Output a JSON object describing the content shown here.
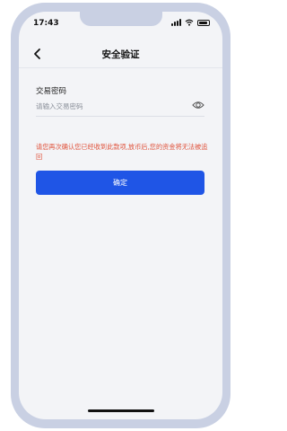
{
  "status_bar": {
    "time": "17:43",
    "icons": [
      "signal-icon",
      "wifi-icon",
      "battery-icon"
    ]
  },
  "nav": {
    "title": "安全验证",
    "back_icon": "chevron-left-icon"
  },
  "form": {
    "field_label": "交易密码",
    "password_value": "",
    "password_placeholder": "请输入交易密码",
    "toggle_icon": "eye-icon"
  },
  "warning": {
    "text": "请您再次确认您已经收到此款项,放币后,您的资金将无法被追回"
  },
  "confirm_button": {
    "label": "确定"
  },
  "colors": {
    "accent": "#1f55e6",
    "warning": "#e0533c",
    "screen_background": "#f3f4f7",
    "frame": "#c9d0e3"
  }
}
